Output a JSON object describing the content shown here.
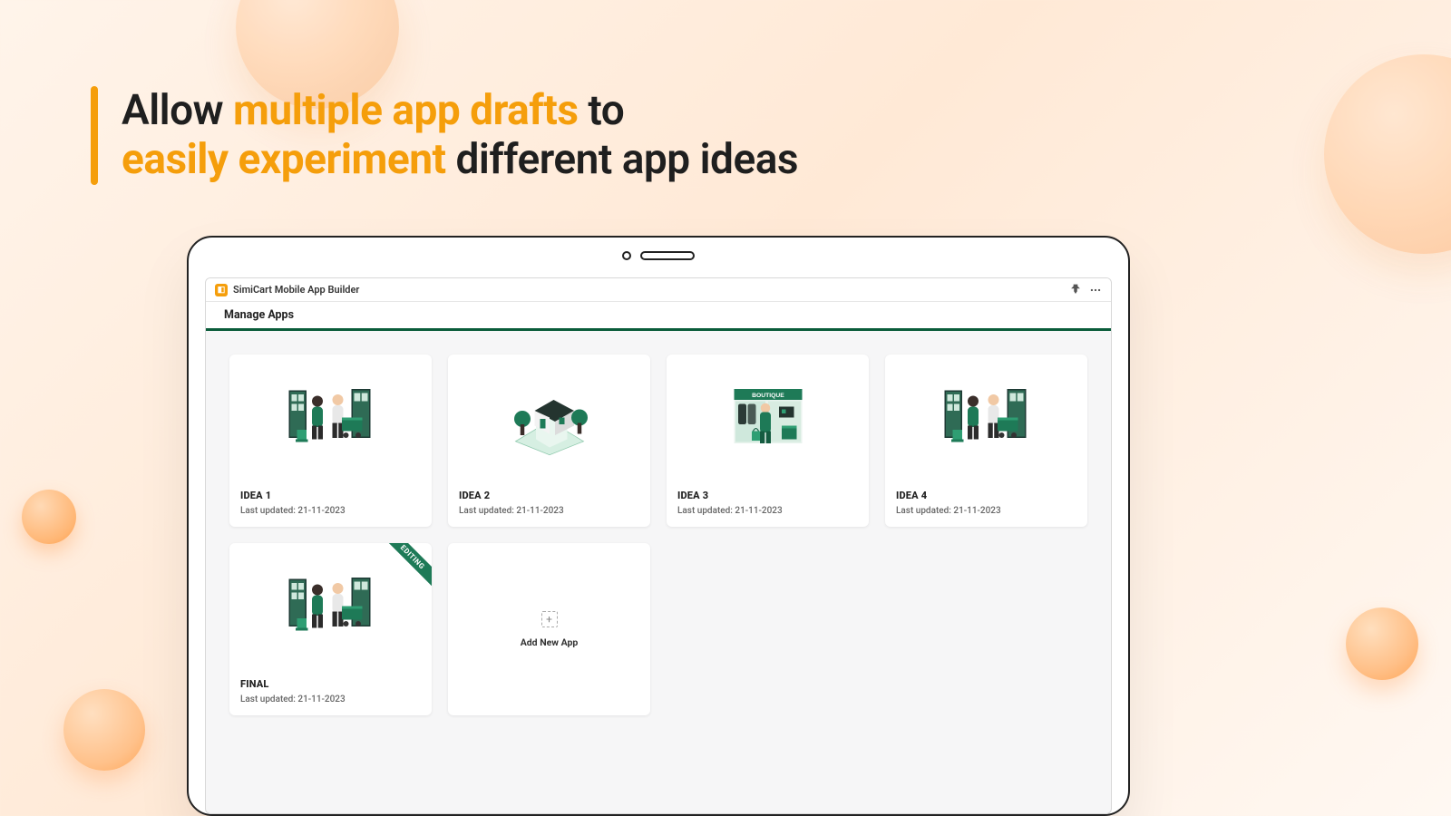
{
  "headline": {
    "p1": "Allow ",
    "p2": "multiple app drafts",
    "p3": " to",
    "p4": "easily experiment",
    "p5": " different app ideas"
  },
  "app": {
    "title": "SimiCart Mobile App Builder",
    "section": "Manage Apps"
  },
  "cards": [
    {
      "title": "IDEA 1",
      "sub": "Last updated: 21-11-2023",
      "illus": "shopping",
      "editing": false
    },
    {
      "title": "IDEA 2",
      "sub": "Last updated: 21-11-2023",
      "illus": "house",
      "editing": false
    },
    {
      "title": "IDEA 3",
      "sub": "Last updated: 21-11-2023",
      "illus": "boutique",
      "editing": false
    },
    {
      "title": "IDEA 4",
      "sub": "Last updated: 21-11-2023",
      "illus": "shopping",
      "editing": false
    },
    {
      "title": "FINAL",
      "sub": "Last updated: 21-11-2023",
      "illus": "shopping",
      "editing": true
    }
  ],
  "labels": {
    "editing_ribbon": "EDITING",
    "add_new": "Add New App",
    "boutique_sign": "BOUTIQUE"
  },
  "colors": {
    "accent": "#f59e0b",
    "brand_green": "#1e7a57"
  }
}
